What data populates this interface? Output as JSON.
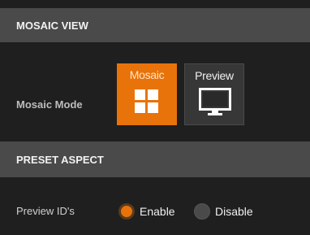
{
  "mosaic_view": {
    "title": "MOSAIC VIEW",
    "mode_label": "Mosaic Mode",
    "selected_mode": "Mosaic",
    "buttons": [
      {
        "label": "Mosaic",
        "icon": "mosaic-grid-icon",
        "active": true
      },
      {
        "label": "Preview",
        "icon": "monitor-icon",
        "active": false
      }
    ]
  },
  "preset_aspect": {
    "title": "PRESET ASPECT",
    "preview_ids_label": "Preview ID's",
    "options": [
      {
        "label": "Enable",
        "selected": true
      },
      {
        "label": "Disable",
        "selected": false
      }
    ]
  },
  "colors": {
    "accent": "#e8730a",
    "header_bg": "#4a4a4a",
    "panel_bg": "#1f1f1f"
  }
}
